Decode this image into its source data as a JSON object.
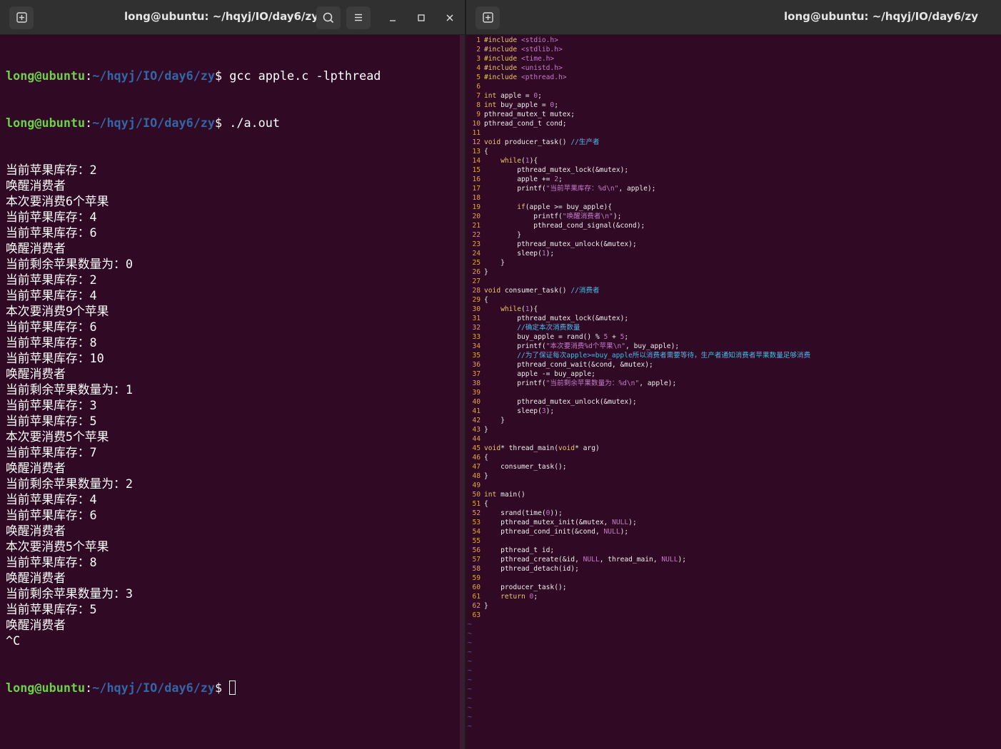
{
  "left_window": {
    "title": "long@ubuntu: ~/hqyj/IO/day6/zy",
    "prompt": {
      "user": "long@ubuntu",
      "sep": ":",
      "path": "~/hqyj/IO/day6/zy",
      "symbol": "$ "
    },
    "commands": [
      "gcc apple.c -lpthread",
      "./a.out"
    ],
    "output": [
      "当前苹果库存：2",
      "唤醒消费者",
      "本次要消费6个苹果",
      "当前苹果库存：4",
      "当前苹果库存：6",
      "唤醒消费者",
      "当前剩余苹果数量为：0",
      "当前苹果库存：2",
      "当前苹果库存：4",
      "本次要消费9个苹果",
      "当前苹果库存：6",
      "当前苹果库存：8",
      "当前苹果库存：10",
      "唤醒消费者",
      "当前剩余苹果数量为：1",
      "当前苹果库存：3",
      "当前苹果库存：5",
      "本次要消费5个苹果",
      "当前苹果库存：7",
      "唤醒消费者",
      "当前剩余苹果数量为：2",
      "当前苹果库存：4",
      "当前苹果库存：6",
      "唤醒消费者",
      "本次要消费5个苹果",
      "当前苹果库存：8",
      "唤醒消费者",
      "当前剩余苹果数量为：3",
      "当前苹果库存：5",
      "唤醒消费者",
      "^C"
    ]
  },
  "right_window": {
    "title": "long@ubuntu: ~/hqyj/IO/day6/zy",
    "code": [
      "#include <stdio.h>",
      "#include <stdlib.h>",
      "#include <time.h>",
      "#include <unistd.h>",
      "#include <pthread.h>",
      "",
      "int apple = 0;",
      "int buy_apple = 0;",
      "pthread_mutex_t mutex;",
      "pthread_cond_t cond;",
      "",
      "void producer_task() //生产者",
      "{",
      "    while(1){",
      "        pthread_mutex_lock(&mutex);",
      "        apple += 2;",
      "        printf(\"当前苹果库存：%d\\n\", apple);",
      "",
      "        if(apple >= buy_apple){",
      "            printf(\"唤醒消费者\\n\");",
      "            pthread_cond_signal(&cond);",
      "        }",
      "        pthread_mutex_unlock(&mutex);",
      "        sleep(1);",
      "    }",
      "}",
      "",
      "void consumer_task() //消费者",
      "{",
      "    while(1){",
      "        pthread_mutex_lock(&mutex);",
      "        //确定本次消费数量",
      "        buy_apple = rand() % 5 + 5;",
      "        printf(\"本次要消费%d个苹果\\n\", buy_apple);",
      "        //为了保证每次apple>=buy_apple所以消费者需要等待，生产者通知消费者苹果数量足够消费",
      "        pthread_cond_wait(&cond, &mutex);",
      "        apple -= buy_apple;",
      "        printf(\"当前剩余苹果数量为：%d\\n\", apple);",
      "",
      "        pthread_mutex_unlock(&mutex);",
      "        sleep(3);",
      "    }",
      "}",
      "",
      "void* thread_main(void* arg)",
      "{",
      "    consumer_task();",
      "}",
      "",
      "int main()",
      "{",
      "    srand(time(0));",
      "    pthread_mutex_init(&mutex, NULL);",
      "    pthread_cond_init(&cond, NULL);",
      "",
      "    pthread_t id;",
      "    pthread_create(&id, NULL, thread_main, NULL);",
      "    pthread_detach(id);",
      "",
      "    producer_task();",
      "    return 0;",
      "}",
      ""
    ],
    "tilde_rows": [
      "~",
      "~",
      "~",
      "~",
      "~",
      "~",
      "~",
      "~",
      "~",
      "~",
      "~",
      "~"
    ]
  },
  "colors": {
    "terminal_bg": "#300a24",
    "titlebar_bg": "#303030",
    "prompt_user": "#6ed04a",
    "prompt_path": "#3465a4",
    "line_number": "#e2a43f",
    "comment": "#4fb6e6",
    "string": "#c37ac8"
  },
  "icons": [
    "new-tab-icon",
    "search-icon",
    "hamburger-menu-icon",
    "minimize-icon",
    "maximize-icon",
    "close-icon"
  ]
}
